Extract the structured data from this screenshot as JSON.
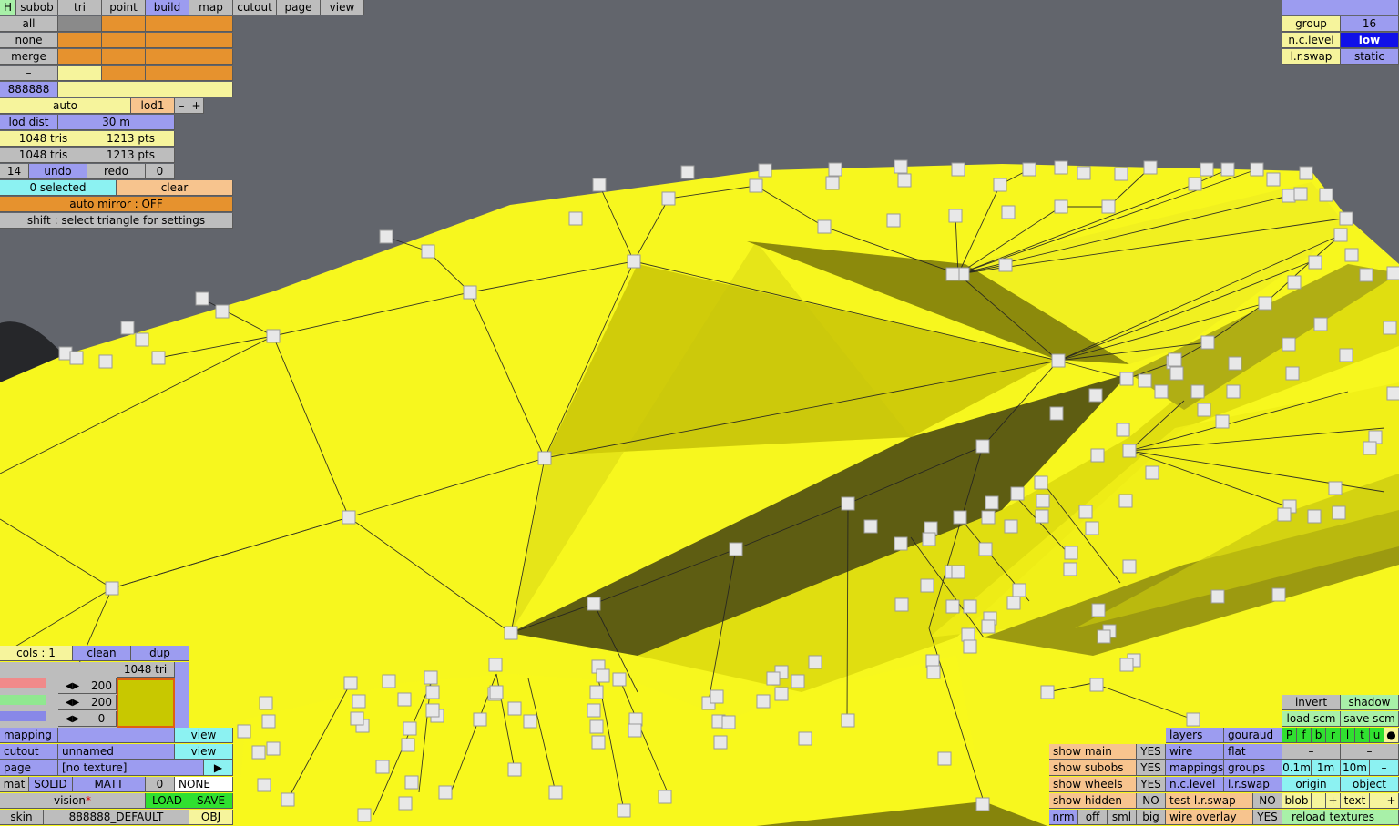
{
  "tabs": [
    "H",
    "subob",
    "tri",
    "point",
    "build",
    "map",
    "cutout",
    "page",
    "view"
  ],
  "left": {
    "all": "all",
    "none": "none",
    "merge": "merge",
    "dash": "–",
    "color_code": "888888",
    "auto": "auto",
    "lod": "lod1",
    "minus": "–",
    "plus": "+",
    "lod_dist_label": "lod dist",
    "lod_dist_value": "30 m",
    "tris1": "1048 tris",
    "pts1": "1213 pts",
    "tris2": "1048 tris",
    "pts2": "1213 pts",
    "undo_count": "14",
    "undo": "undo",
    "redo": "redo",
    "redo_count": "0",
    "selected": "0 selected",
    "clear": "clear",
    "auto_mirror": "auto mirror : OFF",
    "shift_hint": "shift : select triangle for settings"
  },
  "topright": {
    "group_label": "group",
    "group_value": "16",
    "nc_level_label": "n.c.level",
    "nc_level_value": "low",
    "lr_swap_label": "l.r.swap",
    "lr_swap_value": "static"
  },
  "material": {
    "cols": "cols : 1",
    "clean": "clean",
    "dup": "dup",
    "tri_count": "1048 tri",
    "slider1": "200",
    "slider2": "200",
    "slider3": "0",
    "mapping": "mapping",
    "mapping_view": "view",
    "cutout": "cutout",
    "cutout_value": "unnamed",
    "cutout_view": "view",
    "page": "page",
    "page_value": "[no texture]",
    "page_arrow": "▶",
    "mat": "mat",
    "solid": "SOLID",
    "matt": "MATT",
    "mat_num": "0",
    "mat_none": "NONE",
    "vision": "vision",
    "vision_star": "*",
    "load": "LOAD",
    "save": "SAVE",
    "skin": "skin",
    "skin_value": "888888_DEFAULT",
    "obj": "OBJ",
    "color_hex": "#c8c800"
  },
  "show": {
    "main": "show main",
    "main_v": "YES",
    "subobs": "show subobs",
    "subobs_v": "YES",
    "wheels": "show wheels",
    "wheels_v": "YES",
    "hidden": "show hidden",
    "hidden_v": "NO",
    "nrm": "nrm",
    "off": "off",
    "sml": "sml",
    "big": "big"
  },
  "render": {
    "layers": "layers",
    "gouraud": "gouraud",
    "wire": "wire",
    "flat": "flat",
    "mappings": "mappings",
    "groups": "groups",
    "nc_level": "n.c.level",
    "lr_swap": "l.r.swap",
    "test_lr": "test l.r.swap",
    "test_lr_v": "NO",
    "wire_overlay": "wire overlay",
    "wire_overlay_v": "YES"
  },
  "br": {
    "invert": "invert",
    "shadow": "shadow",
    "load_scm": "load scm",
    "save_scm": "save scm",
    "flags": [
      "P",
      "f",
      "b",
      "r",
      "l",
      "t",
      "u",
      "●"
    ],
    "dash1": "–",
    "dash2": "–",
    "g01": "0.1m",
    "g1": "1m",
    "g10": "10m",
    "gm": "–",
    "origin": "origin",
    "object": "object",
    "blob": "blob",
    "bm": "–",
    "bp": "+",
    "text": "text",
    "tm": "–",
    "tp": "+",
    "reload": "reload textures"
  }
}
